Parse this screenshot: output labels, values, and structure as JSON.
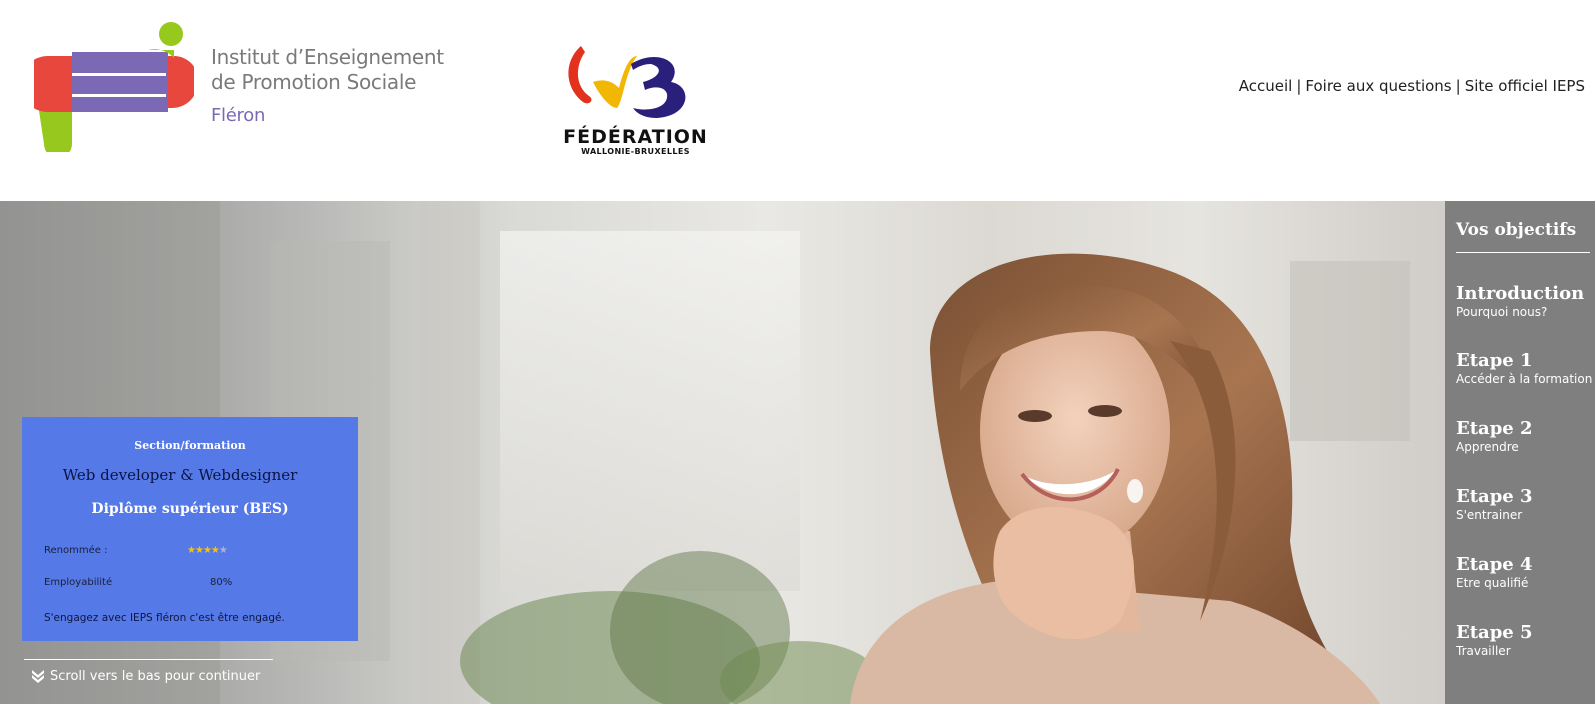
{
  "header": {
    "institute_name_line1": "Institut d’Enseignement",
    "institute_name_line2": "de Promotion Sociale",
    "institute_city": "Fléron",
    "federation_word": "FÉDÉRATION",
    "federation_sub": "WALLONIE-BRUXELLES",
    "logo_ieps_icon": "ieps-logo-icon",
    "logo_fwb_icon": "fwb-logo-icon"
  },
  "nav": {
    "items": [
      {
        "label": "Accueil"
      },
      {
        "label": "Foire aux questions"
      },
      {
        "label": "Site officiel IEPS"
      }
    ],
    "separator": "|"
  },
  "sidebar": {
    "title": "Vos objectifs",
    "items": [
      {
        "heading": "Introduction",
        "sub": "Pourquoi nous?"
      },
      {
        "heading": "Etape 1",
        "sub": "Accéder à la formation"
      },
      {
        "heading": "Etape 2",
        "sub": "Apprendre"
      },
      {
        "heading": "Etape 3",
        "sub": "S'entrainer"
      },
      {
        "heading": "Etape 4",
        "sub": "Etre qualifié"
      },
      {
        "heading": "Etape 5",
        "sub": "Travailler"
      }
    ]
  },
  "card": {
    "kicker": "Section/formation",
    "title": "Web developer & Webdesigner",
    "diploma": "Diplôme supérieur (BES)",
    "reputation_label": "Renommée :",
    "reputation_stars": 4,
    "reputation_max": 5,
    "employability_label": "Employabilité",
    "employability_value": "80%",
    "tagline": "S'engagez avec IEPS fléron c'est être engagé."
  },
  "scroll_hint": {
    "label": "Scroll vers le bas pour continuer",
    "icon": "double-chevron-down-icon"
  },
  "colors": {
    "card_bg": "#5579e6",
    "sidebar_bg": "#7f7f7f",
    "logo_purple": "#7b69b6",
    "logo_red": "#e8473d",
    "logo_green": "#96c81e"
  }
}
